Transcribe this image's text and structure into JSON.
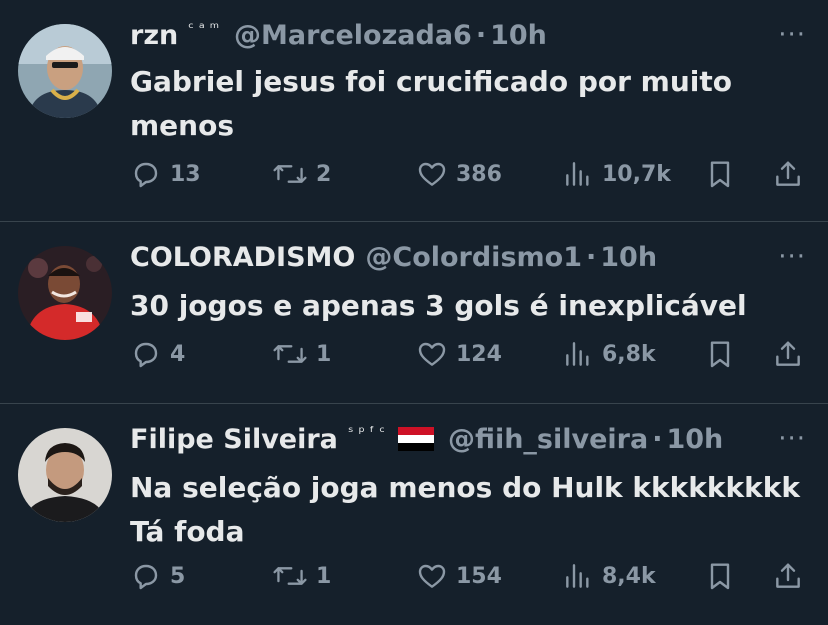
{
  "tweets": [
    {
      "display_name": "rzn",
      "name_sup": "ᶜᵃᵐ",
      "handle": "@Marcelozada6",
      "time": "10h",
      "text_lines": [
        "Gabriel jesus foi crucificado por muito",
        "menos"
      ],
      "replies": "13",
      "retweets": "2",
      "likes": "386",
      "views": "10,7k"
    },
    {
      "display_name": "COLORADISMO",
      "name_sup": "",
      "handle": "@Colordismo1",
      "time": "10h",
      "text_lines": [
        "30 jogos e apenas 3 gols é inexplicável"
      ],
      "replies": "4",
      "retweets": "1",
      "likes": "124",
      "views": "6,8k"
    },
    {
      "display_name": "Filipe Silveira",
      "name_sup": "ˢᵖᶠᶜ",
      "handle": "@fiih_silveira",
      "time": "10h",
      "text_lines": [
        "Na seleção joga menos do Hulk kkkkkkkkk",
        "Tá foda"
      ],
      "replies": "5",
      "retweets": "1",
      "likes": "154",
      "views": "8,4k"
    }
  ],
  "separator": "·",
  "more_glyph": "···",
  "colors": {
    "background": "#15202b",
    "text": "#e7e9ea",
    "muted": "#8b98a5",
    "divider": "#38444d"
  }
}
